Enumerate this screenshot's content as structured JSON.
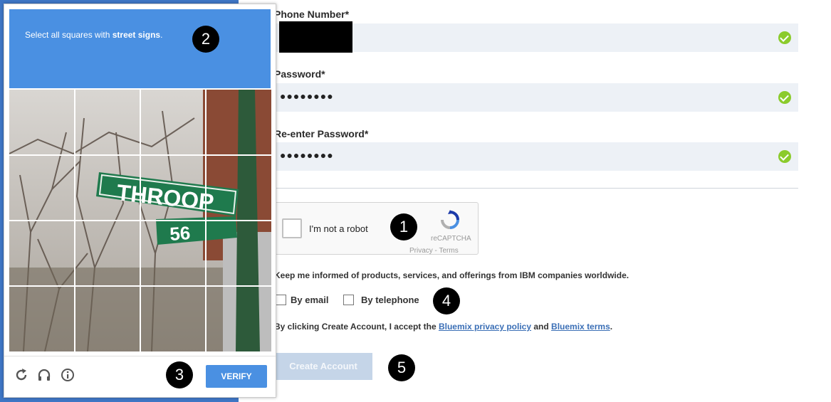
{
  "form": {
    "phone_label": "Phone Number*",
    "password_label": "Password*",
    "password_mask": "●●●●●●●●",
    "reenter_label": "Re-enter Password*",
    "reenter_mask": "●●●●●●●●"
  },
  "recaptcha": {
    "checkbox_label": "I'm not a robot",
    "brand": "reCAPTCHA",
    "links": "Privacy - Terms"
  },
  "marketing": {
    "info_text": "Keep me informed of products, services, and offerings from IBM companies worldwide.",
    "by_email": "By email",
    "by_telephone": "By telephone"
  },
  "terms": {
    "prefix": "By clicking Create Account, I accept the ",
    "privacy_link": "Bluemix privacy policy",
    "and": " and ",
    "terms_link": "Bluemix terms",
    "suffix": "."
  },
  "create_button": "Create Account",
  "captcha": {
    "instruction_prefix": "Select all squares with ",
    "instruction_target": "street signs",
    "instruction_suffix": ".",
    "verify_label": "VERIFY",
    "grid_rows": 4,
    "grid_cols": 4,
    "icons": [
      "reload-icon",
      "audio-headphones-icon",
      "info-icon"
    ]
  },
  "callouts": [
    "1",
    "2",
    "3",
    "4",
    "5"
  ],
  "colors": {
    "captcha_blue": "#4a90e2",
    "page_blue": "#3f76c5",
    "field_bg": "#edf1f6",
    "valid_green": "#8bcb2c",
    "link_blue": "#3b6fb6",
    "disabled_button": "#c5d5e8"
  }
}
